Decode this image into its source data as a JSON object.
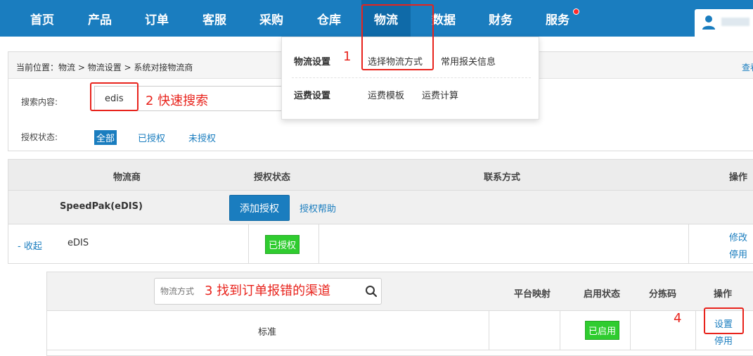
{
  "nav": {
    "items": [
      {
        "label": "首页"
      },
      {
        "label": "产品"
      },
      {
        "label": "订单"
      },
      {
        "label": "客服"
      },
      {
        "label": "采购"
      },
      {
        "label": "仓库"
      },
      {
        "label": "物流"
      },
      {
        "label": "数据"
      },
      {
        "label": "财务"
      },
      {
        "label": "服务"
      }
    ],
    "active_index": 6,
    "notification_dot_on": "服务",
    "accent_color": "#1a7dbf",
    "dot_color": "#ff2a2a"
  },
  "dropdown": {
    "groups": [
      {
        "title": "物流设置",
        "links": [
          "选择物流方式",
          "常用报关信息"
        ]
      },
      {
        "title": "运费设置",
        "links": [
          "运费模板",
          "运费计算"
        ]
      }
    ]
  },
  "breadcrumb": {
    "prefix": "当前位置：",
    "path": "物流 > 物流设置 > 系统对接物流商",
    "right_link": "查看"
  },
  "search": {
    "label": "搜索内容:",
    "value": "edis"
  },
  "filter": {
    "label": "授权状态:",
    "options": [
      "全部",
      "已授权",
      "未授权"
    ],
    "selected": "全部"
  },
  "table": {
    "headers": [
      "物流商",
      "授权状态",
      "联系方式",
      "操作"
    ],
    "carrier": {
      "name": "SpeedPak(eDIS)",
      "add_button": "添加授权",
      "help_link": "授权帮助"
    },
    "account": {
      "toggle": "- 收起",
      "name": "eDIS",
      "status": "已授权",
      "actions": [
        "修改",
        "停用"
      ]
    }
  },
  "channels": {
    "search_placeholder": "物流方式",
    "headers": [
      "平台映射",
      "启用状态",
      "分拣码",
      "操作"
    ],
    "rows": [
      {
        "name": "标准",
        "status": "已启用",
        "actions": [
          "设置",
          "停用"
        ]
      }
    ]
  },
  "annotations": {
    "step1": "1",
    "step2": "2 快速搜索",
    "step3": "3 找到订单报错的渠道",
    "step4": "4",
    "color": "#e8231c"
  }
}
